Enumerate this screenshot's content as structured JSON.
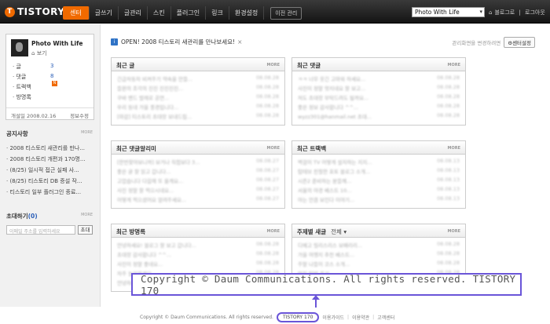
{
  "topbar": {
    "logo": "TISTORY",
    "logo_badge": "T",
    "menu": [
      "센터",
      "글쓰기",
      "글관리",
      "스킨",
      "플러그인",
      "링크",
      "환경설정"
    ],
    "old_admin": "이전 관리",
    "blog_select": "Photo With Life",
    "blog_home": "블로그로",
    "logout": "로그아웃"
  },
  "profile": {
    "blog_name": "Photo With Life",
    "view_link": "보기",
    "stats": [
      {
        "label": "글",
        "value": "3"
      },
      {
        "label": "댓글",
        "value": "8"
      },
      {
        "label": "트랙백",
        "value": ""
      },
      {
        "label": "방명록",
        "value": ""
      }
    ],
    "new_badge": "N",
    "opened": "개설일 2008.02.16",
    "info_edit": "정보수정"
  },
  "notices": {
    "title": "공지사항",
    "more": "MORE",
    "items": [
      "2008 티스토리 새관리를 만나...",
      "2008 티스토리 개편과 170명...",
      "(8/25) 일시적 접근 실패 사...",
      "(8/25) 티스토리 DB 증설 작...",
      "티스토리 일부 플러그인 종료..."
    ]
  },
  "invite": {
    "title": "초대하기",
    "count": "(0)",
    "more": "MORE",
    "placeholder": "이메일 주소를 입력하세요",
    "button": "초대"
  },
  "notice_bar": {
    "icon": "i",
    "text": "OPEN! 2008 티스토리 새관리를 만나보세요!",
    "close": "×",
    "hint": "관리화면을 변경하려면",
    "button": "센터설정"
  },
  "panels": {
    "recent_posts": {
      "title": "최근 글",
      "more": "MORE"
    },
    "recent_comments": {
      "title": "최근 댓글",
      "more": "MORE"
    },
    "comment_alerts": {
      "title": "최근 댓글알리미",
      "more": "MORE"
    },
    "recent_trackbacks": {
      "title": "최근 트랙백",
      "more": "MORE"
    },
    "recent_guestbook": {
      "title": "최근 방명록",
      "more": "MORE"
    },
    "tags": {
      "title": "주제별 새글",
      "more": "MORE",
      "select": "전체"
    }
  },
  "panel_rows": {
    "recent_posts": [
      {
        "t": "긴급자동차 비켜주기 약속을 만들...",
        "d": "08.08.28"
      },
      {
        "t": "들판의 조각의 진진 진진진진...",
        "d": "08.08.28"
      },
      {
        "t": "쿠바 밴드 발레로 공연...",
        "d": "08.08.28"
      },
      {
        "t": "우리 동네 가을 풍경입니다...",
        "d": "08.08.28"
      },
      {
        "t": "[마감] 티스토리 초대장 보내드립...",
        "d": "08.08.28"
      }
    ],
    "recent_comments": [
      {
        "t": "ㅋㅋ 너무 웃긴 고마워 하세요...",
        "d": "08.08.28"
      },
      {
        "t": "사진이 정말 멋지네요 잘 보고...",
        "d": "08.08.28"
      },
      {
        "t": "저도 초대장 부탁드려도 될까요...",
        "d": "08.08.28"
      },
      {
        "t": "좋은 정보 감사합니다 ^^...",
        "d": "08.08.28"
      },
      {
        "t": "wyzz301@hanmail.net 초대...",
        "d": "08.08.28"
      }
    ],
    "comment_alerts": [
      {
        "t": "[한번찾아보니까] 보거나 직접보다 3...",
        "d": "08.08.27"
      },
      {
        "t": "좋은 글 잘 읽고 갑니다...",
        "d": "08.08.27"
      },
      {
        "t": "고맙습니다 다음에 또 올게요...",
        "d": "08.08.27"
      },
      {
        "t": "사진 정말 잘 찍으시네요...",
        "d": "08.08.27"
      },
      {
        "t": "어떻게 찍으셨어요 알려주세요...",
        "d": "08.08.27"
      }
    ],
    "recent_trackbacks": [
      {
        "t": "벽걸이 TV 어떻게 설치하는 지지...",
        "d": "08.08.13"
      },
      {
        "t": "탑테브 친절한 포토 블로그 소개...",
        "d": "08.08.13"
      },
      {
        "t": "시즌2 준비하는 분들께...",
        "d": "08.08.13"
      },
      {
        "t": "서울의 야경 베스트 10...",
        "d": "08.08.13"
      },
      {
        "t": "아는 만큼 보인다 이야기...",
        "d": "08.08.13"
      }
    ],
    "recent_guestbook": [
      {
        "t": "안녕하세요! 블로그 잘 보고 갑니다...",
        "d": "08.08.28"
      },
      {
        "t": "초대장 감사합니다 ^^...",
        "d": "08.08.28"
      },
      {
        "t": "사진이 정말 좋네요...",
        "d": "08.08.28"
      },
      {
        "t": "자주 놀러올게요...",
        "d": "08.08.28"
      },
      {
        "t": "안녕하세요 반갑습니다...",
        "d": "08.08.28"
      }
    ],
    "tags": [
      {
        "t": "디메고 릴리스리스 보배리리...",
        "d": "08.08.28"
      },
      {
        "t": "가을 여행지 추천 베스트...",
        "d": "08.08.28"
      },
      {
        "t": "주말 나들이 코스 소개...",
        "d": "08.08.28"
      },
      {
        "t": "맛집 탐방 후기...",
        "d": "08.08.28"
      },
      {
        "t": "새로운 카메라 리뷰...",
        "d": "08.08.28"
      }
    ]
  },
  "callout": {
    "text": "Copyright © Daum Communications. All rights reserved. TISTORY 170"
  },
  "footer": {
    "copyright": "Copyright © Daum Communications. All rights reserved.",
    "version": "TISTORY 170",
    "guide": "이용가이드",
    "terms": "이용약관",
    "support": "고객센터"
  },
  "colors": {
    "accent": "#f06a00",
    "highlight": "#6a55d8",
    "link": "#2b5fb8"
  }
}
